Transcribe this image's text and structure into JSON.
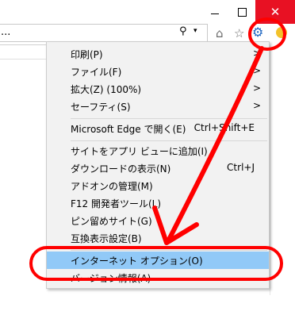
{
  "window": {
    "min_icon": "minimize-icon",
    "max_icon": "maximize-icon",
    "close_glyph": "✕"
  },
  "address_bar": {
    "value": "...",
    "search_glyph": "⚲",
    "dropdown_glyph": "▾"
  },
  "toolbar": {
    "home_glyph": "⌂",
    "star_glyph": "☆",
    "gear_glyph": "⚙",
    "gear_color": "#1f67c2"
  },
  "menu": {
    "items": [
      {
        "label": "印刷(P)",
        "shortcut": "",
        "submenu": ">"
      },
      {
        "label": "ファイル(F)",
        "shortcut": "",
        "submenu": ">"
      },
      {
        "label": "拡大(Z) (100%)",
        "shortcut": "",
        "submenu": ">"
      },
      {
        "label": "セーフティ(S)",
        "shortcut": "",
        "submenu": ">"
      },
      {
        "label": "Microsoft Edge で開く(E)",
        "shortcut": "Ctrl+Shift+E",
        "submenu": ""
      },
      {
        "label": "サイトをアプリ ビューに追加(I)",
        "shortcut": "",
        "submenu": ""
      },
      {
        "label": "ダウンロードの表示(N)",
        "shortcut": "Ctrl+J",
        "submenu": ""
      },
      {
        "label": "アドオンの管理(M)",
        "shortcut": "",
        "submenu": ""
      },
      {
        "label": "F12 開発者ツール(L)",
        "shortcut": "",
        "submenu": ""
      },
      {
        "label": "ピン留めサイト(G)",
        "shortcut": "",
        "submenu": ""
      },
      {
        "label": "互換表示設定(B)",
        "shortcut": "",
        "submenu": ""
      },
      {
        "label": "インターネット オプション(O)",
        "shortcut": "",
        "submenu": ""
      },
      {
        "label": "バージョン情報(A)",
        "shortcut": "",
        "submenu": ""
      }
    ],
    "highlight_color": "#91c9f7"
  },
  "annotation": {
    "color": "#ff0000"
  }
}
